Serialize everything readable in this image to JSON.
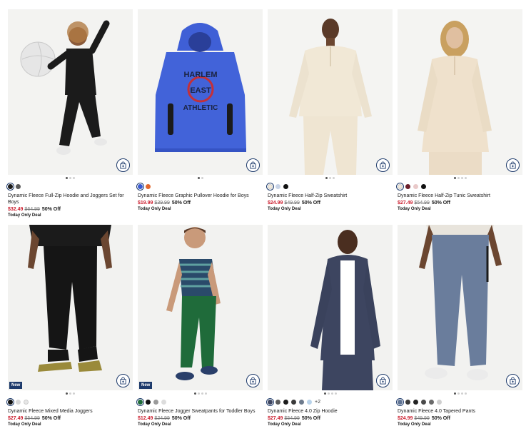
{
  "products": [
    {
      "name": "Dynamic Fleece Full-Zip Hoodie and Joggers Set for Boys",
      "sale_price": "$32.49",
      "original_price": "$64.99",
      "discount": "50% Off",
      "deal": "Today Only Deal",
      "badge": "",
      "more_colors": "",
      "swatches": [
        "#1b1b1b",
        "#5a5a5a"
      ],
      "dots": 3,
      "active_dot": 0,
      "add_to_bag_icon": "shopping-bag-plus-icon",
      "photo_colors": {
        "bg": "#f2f2f0",
        "item": "#1a1a1a"
      }
    },
    {
      "name": "Dynamic Fleece Graphic Pullover Hoodie for Boys",
      "sale_price": "$19.99",
      "original_price": "$39.99",
      "discount": "50% Off",
      "deal": "Today Only Deal",
      "badge": "",
      "more_colors": "",
      "graphic_text": [
        "HARLEM",
        "EAST",
        "ATHLETIC"
      ],
      "swatches": [
        "#3a5bd1",
        "#e2682e"
      ],
      "dots": 2,
      "active_dot": 0,
      "add_to_bag_icon": "shopping-bag-plus-icon",
      "photo_colors": {
        "bg": "#f2f2f0",
        "item": "#4263d9"
      }
    },
    {
      "name": "Dynamic Fleece Half-Zip Sweatshirt",
      "sale_price": "$24.99",
      "original_price": "$49.99",
      "discount": "50% Off",
      "deal": "Today Only Deal",
      "badge": "",
      "more_colors": "",
      "swatches": [
        "#f3ead8",
        "#c8d3e6",
        "#111111"
      ],
      "dots": 3,
      "active_dot": 0,
      "add_to_bag_icon": "shopping-bag-plus-icon",
      "photo_colors": {
        "bg": "#f4f4f2",
        "item": "#f1e8d6"
      }
    },
    {
      "name": "Dynamic Fleece Half-Zip Tunic Sweatshirt",
      "sale_price": "$27.49",
      "original_price": "$54.99",
      "discount": "50% Off",
      "deal": "Today Only Deal",
      "badge": "",
      "more_colors": "",
      "swatches": [
        "#f3ead8",
        "#6b1f2a",
        "#e9c9c9",
        "#111111"
      ],
      "dots": 4,
      "active_dot": 0,
      "add_to_bag_icon": "shopping-bag-plus-icon",
      "photo_colors": {
        "bg": "#f4f4f2",
        "item": "#efe1cc"
      }
    },
    {
      "name": "Dynamic Fleece Mixed Media Joggers",
      "sale_price": "$27.49",
      "original_price": "$54.99",
      "discount": "50% Off",
      "deal": "Today Only Deal",
      "badge": "New",
      "more_colors": "",
      "swatches": [
        "#111111",
        "#d8d8d8",
        "#e6e6e6"
      ],
      "dots": 3,
      "active_dot": 0,
      "add_to_bag_icon": "shopping-bag-plus-icon",
      "photo_colors": {
        "bg": "#f2f2f0",
        "item": "#151515"
      }
    },
    {
      "name": "Dynamic Fleece Jogger Sweatpants for Toddler Boys",
      "sale_price": "$12.49",
      "original_price": "$24.99",
      "discount": "50% Off",
      "deal": "Today Only Deal",
      "badge": "New",
      "more_colors": "",
      "swatches": [
        "#1f6b3a",
        "#111111",
        "#9a9a9a",
        "#dcdcdc"
      ],
      "dots": 4,
      "active_dot": 0,
      "add_to_bag_icon": "shopping-bag-plus-icon",
      "photo_colors": {
        "bg": "#f2f2f0",
        "item": "#1f6b3a"
      }
    },
    {
      "name": "Dynamic Fleece 4.0 Zip Hoodie",
      "sale_price": "$27.49",
      "original_price": "$54.99",
      "discount": "50% Off",
      "deal": "Today Only Deal",
      "badge": "",
      "more_colors": "+2",
      "swatches": [
        "#3d4560",
        "#5a5a5a",
        "#1b1b1b",
        "#3a3a3a",
        "#6d7a8c",
        "#b9d3ea"
      ],
      "dots": 4,
      "active_dot": 0,
      "add_to_bag_icon": "shopping-bag-plus-icon",
      "photo_colors": {
        "bg": "#f2f2f0",
        "item": "#3d4560"
      }
    },
    {
      "name": "Dynamic Fleece 4.0 Tapered Pants",
      "sale_price": "$24.99",
      "original_price": "$49.99",
      "discount": "50% Off",
      "deal": "Today Only Deal",
      "badge": "",
      "more_colors": "",
      "swatches": [
        "#5f7393",
        "#3a3a3a",
        "#222222",
        "#4a4a4a",
        "#6a6a6a",
        "#cfcfcf"
      ],
      "dots": 4,
      "active_dot": 0,
      "add_to_bag_icon": "shopping-bag-plus-icon",
      "photo_colors": {
        "bg": "#f2f2f0",
        "item": "#6a7d9c"
      }
    }
  ]
}
